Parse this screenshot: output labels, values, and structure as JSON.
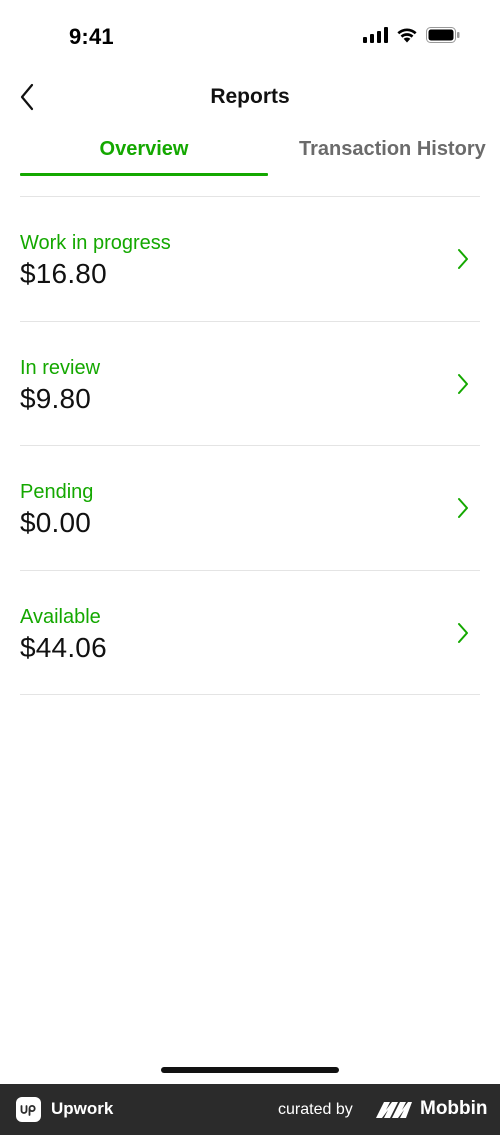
{
  "status_bar": {
    "time": "9:41",
    "icons": [
      "signal-icon",
      "wifi-icon",
      "battery-icon"
    ]
  },
  "header": {
    "title": "Reports",
    "back_icon": "chevron-left-icon"
  },
  "tabs": [
    {
      "label": "Overview",
      "active": true
    },
    {
      "label": "Transaction History",
      "active": false
    }
  ],
  "list": {
    "items": [
      {
        "label": "Work in progress",
        "amount": "$16.80",
        "icon": "chevron-right-icon"
      },
      {
        "label": "In review",
        "amount": "$9.80",
        "icon": "chevron-right-icon"
      },
      {
        "label": "Pending",
        "amount": "$0.00",
        "icon": "chevron-right-icon"
      },
      {
        "label": "Available",
        "amount": "$44.06",
        "icon": "chevron-right-icon"
      }
    ]
  },
  "footer": {
    "app_name": "Upwork",
    "app_logo_text": "up",
    "curated_by": "curated by",
    "brand": "Mobbin"
  },
  "colors": {
    "accent": "#14a800",
    "text": "#111111",
    "muted": "#6b6b6b",
    "divider": "#e4e4e4",
    "footer_bg": "#2b2b2b"
  }
}
